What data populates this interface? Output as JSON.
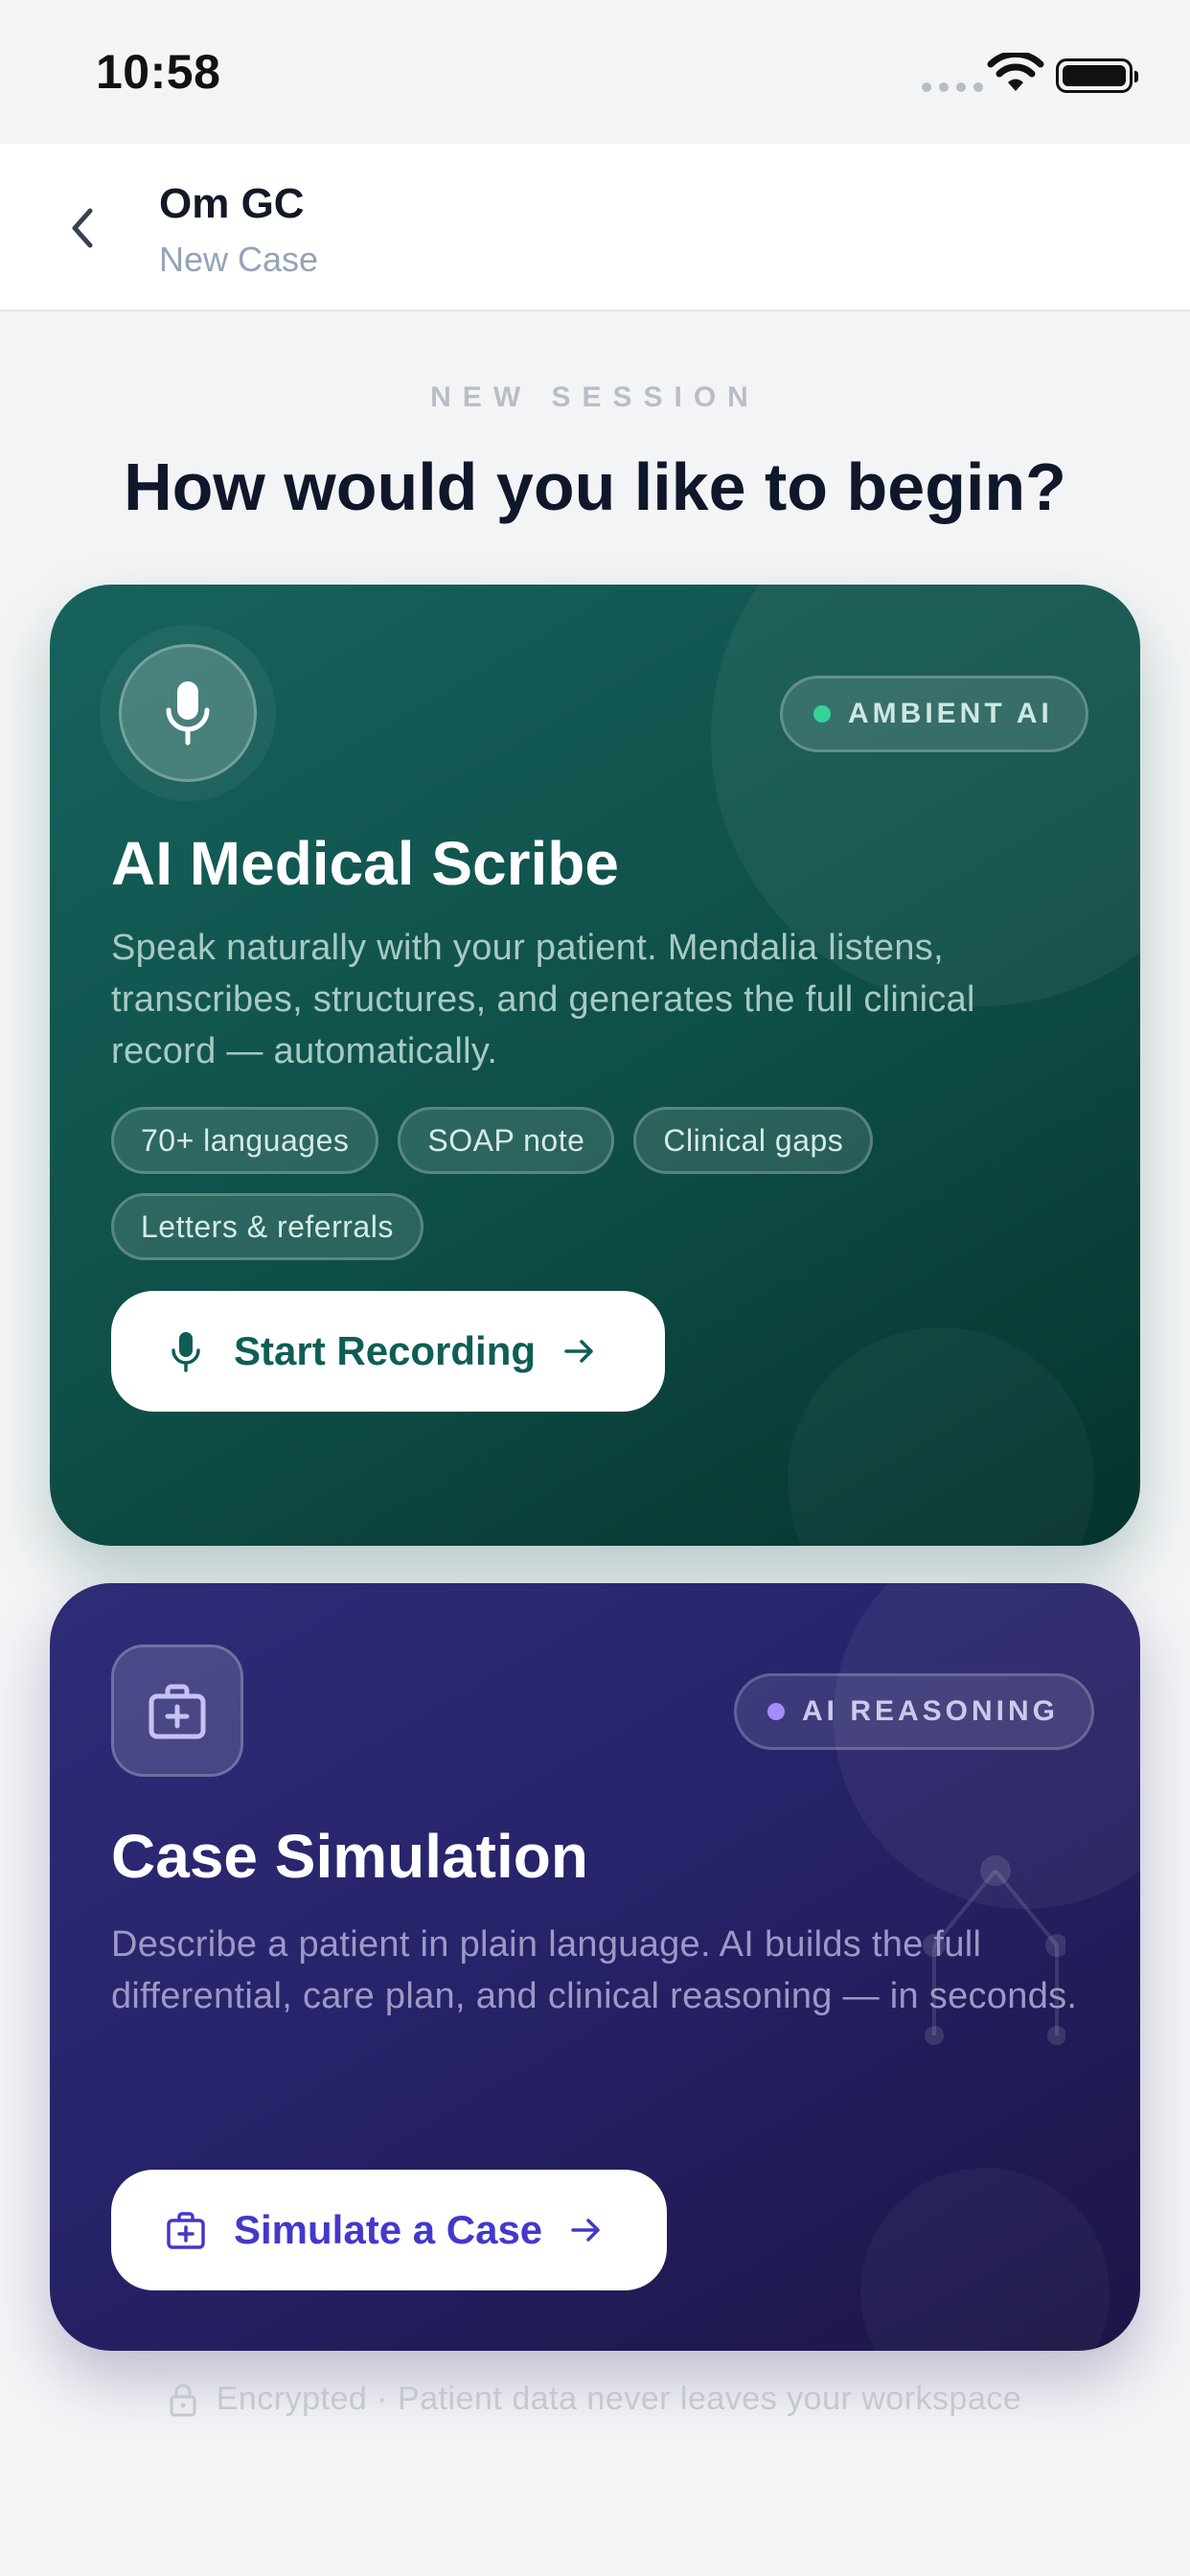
{
  "status_bar": {
    "time": "10:58"
  },
  "header": {
    "title": "Om GC",
    "subtitle": "New Case"
  },
  "intro": {
    "eyebrow": "NEW SESSION",
    "headline": "How would you like to begin?"
  },
  "scribe_card": {
    "badge": "AMBIENT AI",
    "title": "AI Medical Scribe",
    "description": "Speak naturally with your patient. Mendalia listens, transcribes, structures, and generates the full clinical record — automatically.",
    "chips": [
      "70+ languages",
      "SOAP note",
      "Clinical gaps",
      "Letters & referrals"
    ],
    "cta_label": "Start Recording",
    "icon": "microphone-icon",
    "accent": "#34d399"
  },
  "simulation_card": {
    "badge": "AI REASONING",
    "title": "Case Simulation",
    "description": "Describe a patient in plain language. AI builds the full differential, care plan, and clinical reasoning — in seconds.",
    "cta_label": "Simulate a Case",
    "icon": "medical-kit-icon",
    "accent": "#a78bfa"
  },
  "footer": {
    "text": "Encrypted · Patient data never leaves your workspace",
    "icon": "lock-icon"
  }
}
